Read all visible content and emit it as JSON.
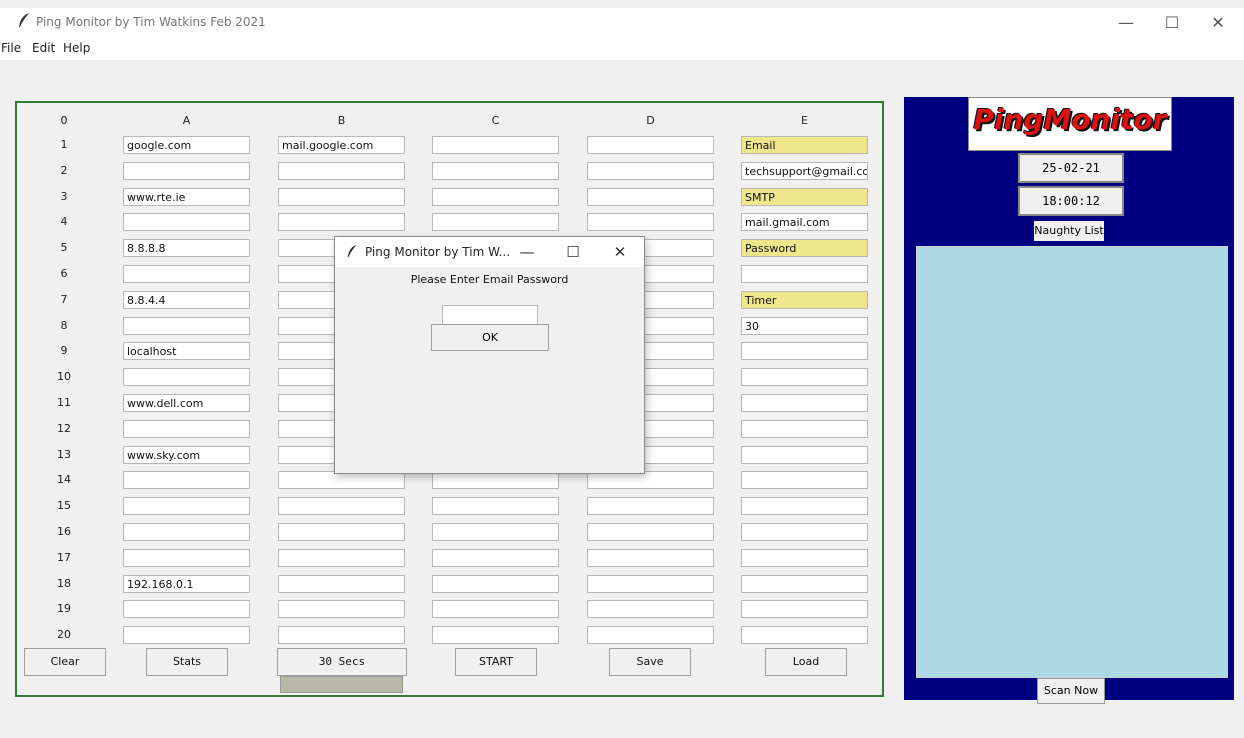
{
  "window": {
    "title": "Ping Monitor by Tim Watkins Feb 2021",
    "minimize": "—",
    "maximize": "☐",
    "close": "✕"
  },
  "menu": [
    "File",
    "Edit",
    "Help"
  ],
  "grid": {
    "corner": "0",
    "columns": [
      "A",
      "B",
      "C",
      "D",
      "E"
    ],
    "rows": [
      {
        "label": "1",
        "cells": [
          "google.com",
          "mail.google.com",
          "",
          "",
          "Email"
        ]
      },
      {
        "label": "2",
        "cells": [
          "",
          "",
          "",
          "",
          "techsupport@gmail.co"
        ]
      },
      {
        "label": "3",
        "cells": [
          "www.rte.ie",
          "",
          "",
          "",
          "SMTP"
        ]
      },
      {
        "label": "4",
        "cells": [
          "",
          "",
          "",
          "",
          "mail.gmail.com"
        ]
      },
      {
        "label": "5",
        "cells": [
          "8.8.8.8",
          "",
          "",
          "",
          "Password"
        ]
      },
      {
        "label": "6",
        "cells": [
          "",
          "",
          "",
          "",
          ""
        ]
      },
      {
        "label": "7",
        "cells": [
          "8.8.4.4",
          "",
          "",
          "",
          "Timer"
        ]
      },
      {
        "label": "8",
        "cells": [
          "",
          "",
          "",
          "",
          "30"
        ]
      },
      {
        "label": "9",
        "cells": [
          "localhost",
          "",
          "",
          "",
          ""
        ]
      },
      {
        "label": "10",
        "cells": [
          "",
          "",
          "",
          "",
          ""
        ]
      },
      {
        "label": "11",
        "cells": [
          "www.dell.com",
          "",
          "",
          "",
          ""
        ]
      },
      {
        "label": "12",
        "cells": [
          "",
          "",
          "",
          "",
          ""
        ]
      },
      {
        "label": "13",
        "cells": [
          "www.sky.com",
          "",
          "",
          "",
          ""
        ]
      },
      {
        "label": "14",
        "cells": [
          "",
          "",
          "",
          "",
          ""
        ]
      },
      {
        "label": "15",
        "cells": [
          "",
          "",
          "",
          "",
          ""
        ]
      },
      {
        "label": "16",
        "cells": [
          "",
          "",
          "",
          "",
          ""
        ]
      },
      {
        "label": "17",
        "cells": [
          "",
          "",
          "",
          "",
          ""
        ]
      },
      {
        "label": "18",
        "cells": [
          "192.168.0.1",
          "",
          "",
          "",
          ""
        ]
      },
      {
        "label": "19",
        "cells": [
          "",
          "",
          "",
          "",
          ""
        ]
      },
      {
        "label": "20",
        "cells": [
          "",
          "",
          "",
          "",
          ""
        ]
      }
    ],
    "highlight_color": "#f0e68c",
    "highlighted_cells_col_E": [
      "Email",
      "SMTP",
      "Password",
      "Timer"
    ]
  },
  "buttons": {
    "clear": "Clear",
    "stats": "Stats",
    "interval": "30 Secs",
    "start": "START",
    "save": "Save",
    "load": "Load"
  },
  "right_panel": {
    "logo": "PingMonitor",
    "date": "25-02-21",
    "time": "18:00:12",
    "naughty_list_label": "Naughty List",
    "scan_now": "Scan Now",
    "panel_color": "#000080",
    "list_color": "#add8e6"
  },
  "dialog": {
    "title": "Ping Monitor by Tim W...",
    "prompt": "Please Enter Email Password",
    "password_value": "",
    "ok": "OK",
    "minimize": "—",
    "maximize": "☐",
    "close": "✕"
  },
  "accent_colors": {
    "frame_border": "#2e7d32",
    "logo_text": "#dd1111"
  }
}
